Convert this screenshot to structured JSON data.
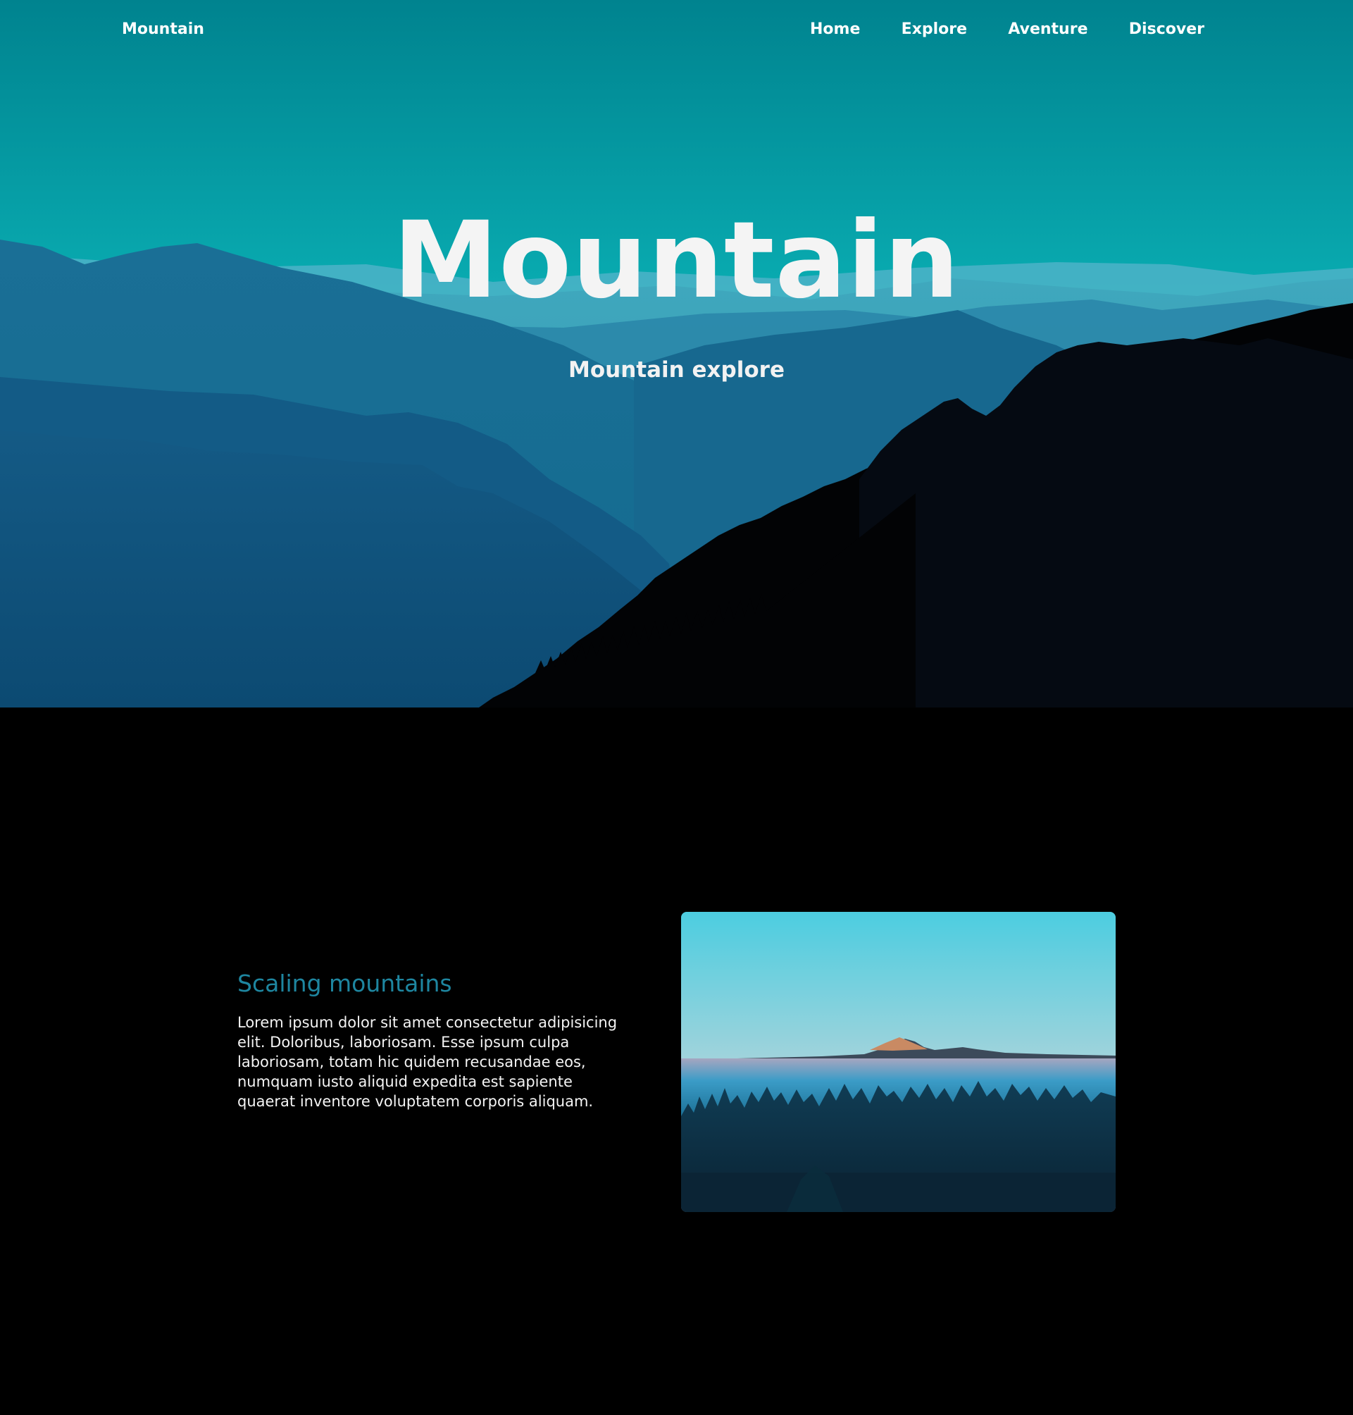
{
  "nav": {
    "logo": "Mountain",
    "links": [
      "Home",
      "Explore",
      "Aventure",
      "Discover"
    ]
  },
  "hero": {
    "title": "Mountain",
    "subtitle": "Mountain explore"
  },
  "feature": {
    "heading": "Scaling mountains",
    "body": "Lorem ipsum dolor sit amet consectetur adipisicing elit. Doloribus, laboriosam. Esse ipsum culpa laboriosam, totam hic quidem recusandae eos, numquam iusto aliquid expedita est sapiente quaerat inventore voluptatem corporis aliquam."
  },
  "colors": {
    "page_background": "#000000",
    "sky_top": "#00838f",
    "sky_light": "#52c7c4",
    "feature_heading": "#1e86a0",
    "text": "#f4f4f4"
  }
}
